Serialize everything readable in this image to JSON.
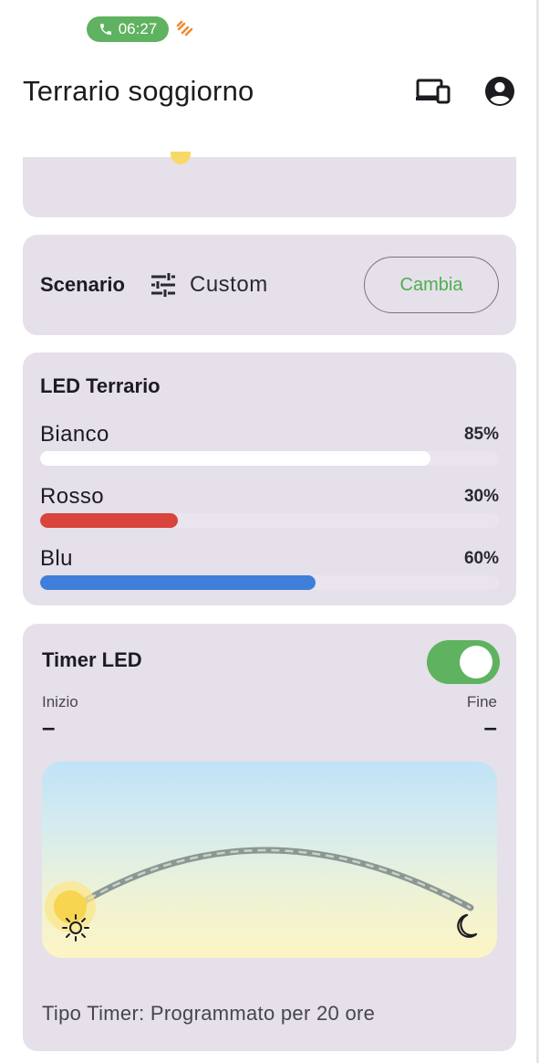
{
  "status_bar": {
    "call_time": "06:27"
  },
  "app_bar": {
    "title": "Terrario soggiorno"
  },
  "scenario": {
    "label": "Scenario",
    "value": "Custom",
    "change_label": "Cambia"
  },
  "led": {
    "title": "LED Terrario",
    "channels": [
      {
        "name": "Bianco",
        "percent_label": "85%",
        "level": 0.85,
        "color": "#ffffff"
      },
      {
        "name": "Rosso",
        "percent_label": "30%",
        "level": 0.3,
        "color": "#d9443c"
      },
      {
        "name": "Blu",
        "percent_label": "60%",
        "level": 0.6,
        "color": "#3f7fd9"
      }
    ]
  },
  "timer": {
    "title": "Timer LED",
    "enabled": true,
    "start_label": "Inizio",
    "start_value": "–",
    "end_label": "Fine",
    "end_value": "–",
    "type_text": "Tipo Timer: Programmato per 20 ore"
  },
  "colors": {
    "accent_green": "#5fb25f",
    "card_bg": "#e5e0e9",
    "sun_yellow": "#f7d96a"
  }
}
